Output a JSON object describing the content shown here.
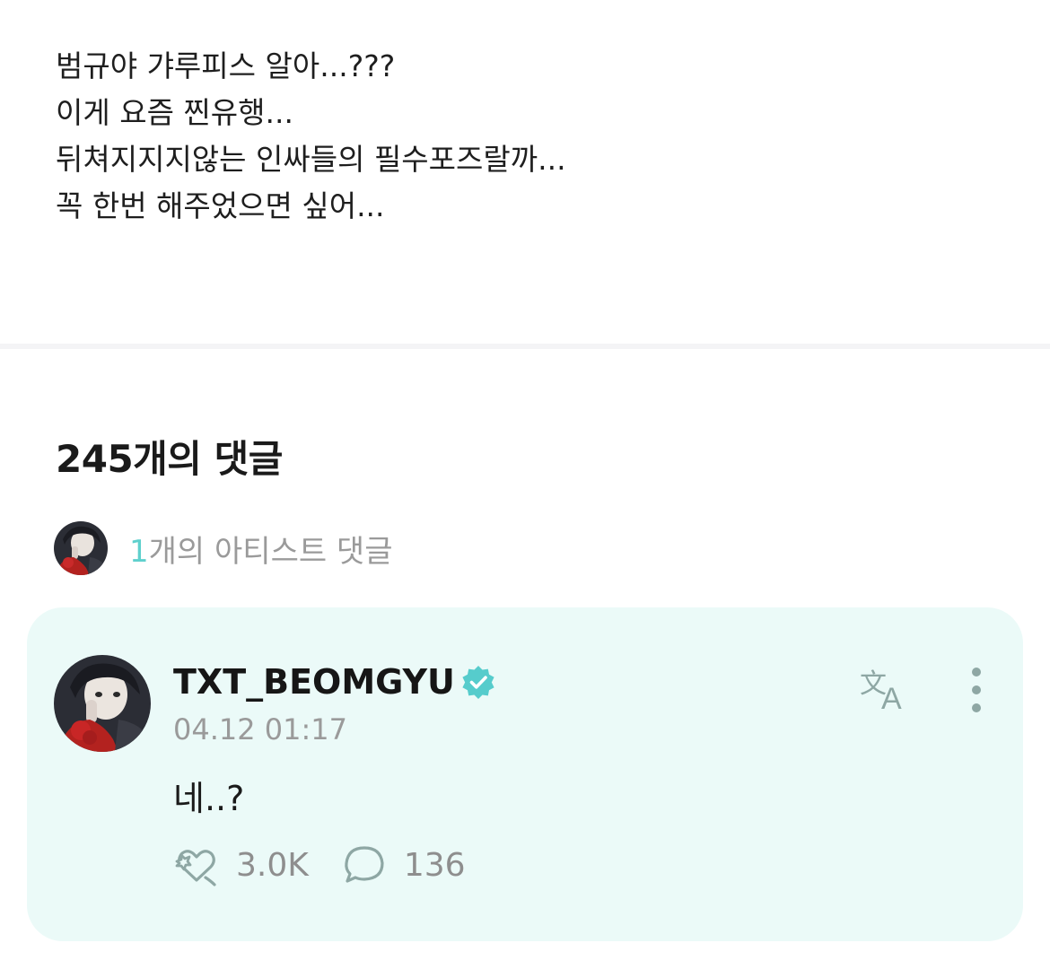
{
  "post": {
    "lines": [
      "범규야 갸루피스 알아...???",
      "이게 요즘 찐유행...",
      "뒤쳐지지지않는 인싸들의 필수포즈랄까...",
      "꼭 한번 해주었으면 싶어..."
    ]
  },
  "comments": {
    "heading": "245개의 댓글",
    "artist_summary": {
      "count": "1",
      "label": "개의 아티스트 댓글"
    }
  },
  "artist_comment": {
    "username": "TXT_BEOMGYU",
    "timestamp": "04.12 01:17",
    "text": "네..?",
    "likes": "3.0K",
    "replies": "136"
  },
  "colors": {
    "accent": "#5fd0cd",
    "card_background": "#ebfaf8",
    "verified": "#56cccc",
    "icon_gray": "#8ea7a4"
  },
  "icons": {
    "verified": "verified-badge-icon",
    "translate": "translate-icon",
    "more": "more-vertical-icon",
    "like": "heart-cheer-icon",
    "reply": "speech-bubble-icon"
  }
}
